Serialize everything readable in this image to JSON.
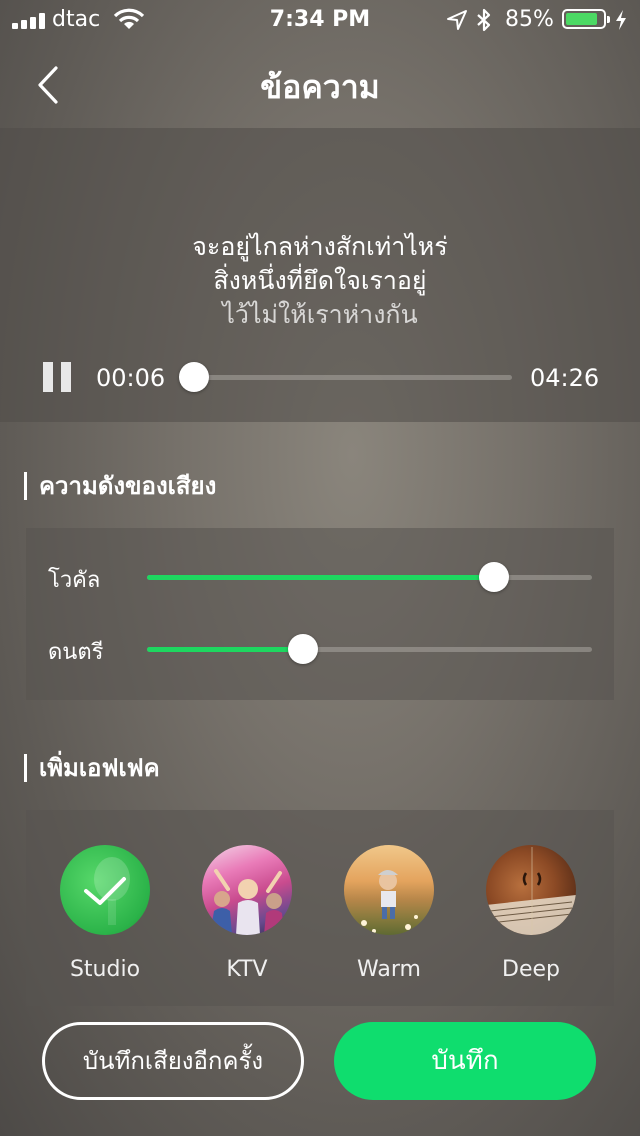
{
  "status_bar": {
    "carrier": "dtac",
    "time": "7:34 PM",
    "battery_percent": "85%",
    "battery_level": 0.85,
    "icons": [
      "signal-icon",
      "wifi-icon",
      "location-arrow-icon",
      "bluetooth-icon",
      "battery-icon",
      "charging-icon"
    ]
  },
  "nav": {
    "title": "ข้อความ",
    "back_icon": "chevron-left-icon"
  },
  "player": {
    "lyrics": [
      "จะอยู่ไกลห่างสักเท่าไหร่",
      "สิ่งหนึ่งที่ยึดใจเราอยู่",
      "ไว้ไม่ให้เราห่างกัน"
    ],
    "current_time": "00:06",
    "total_time": "04:26",
    "progress": 0.02,
    "pause_icon": "pause-icon"
  },
  "volume": {
    "heading": "ความดังของเสียง",
    "vocal_label": "โวคัล",
    "vocal_level": 0.78,
    "music_label": "ดนตรี",
    "music_level": 0.35
  },
  "effects": {
    "heading": "เพิ่มเอฟเฟค",
    "items": [
      {
        "label": "Studio",
        "selected": true
      },
      {
        "label": "KTV",
        "selected": false
      },
      {
        "label": "Warm",
        "selected": false
      },
      {
        "label": "Deep",
        "selected": false
      }
    ]
  },
  "actions": {
    "retry_label": "บันทึกเสียงอีกครั้ง",
    "save_label": "บันทึก"
  },
  "colors": {
    "accent": "#1ed760",
    "save_button": "#0fdd6e",
    "battery": "#4cd964"
  }
}
